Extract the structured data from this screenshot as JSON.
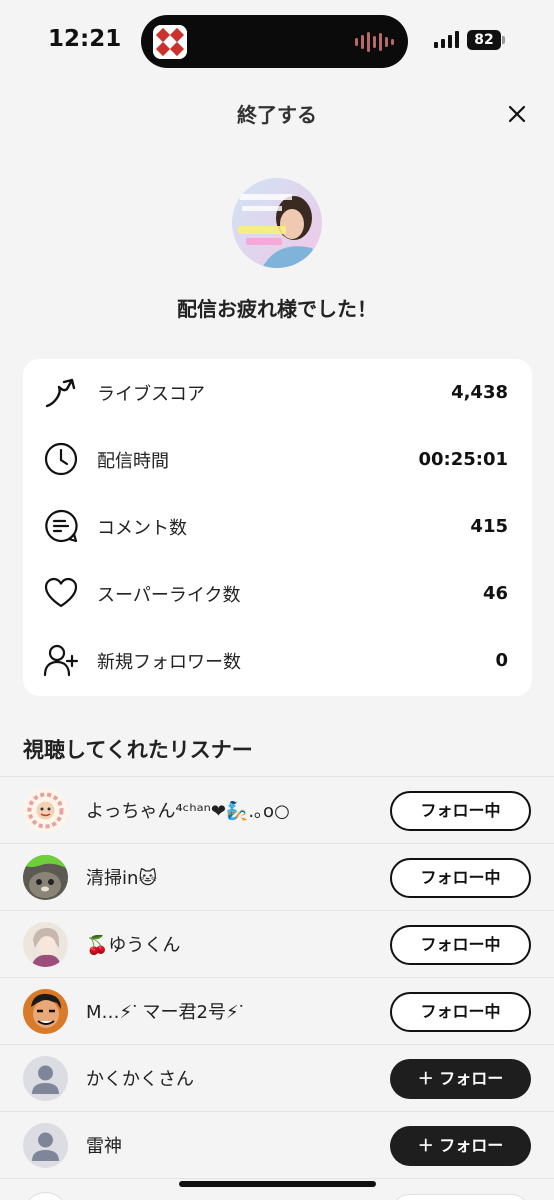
{
  "status_bar": {
    "time": "12:21",
    "battery": "82"
  },
  "header": {
    "title": "終了する"
  },
  "summary": {
    "message": "配信お疲れ様でした！"
  },
  "stats": [
    {
      "icon": "trend-up-arrow-icon",
      "label": "ライブスコア",
      "value": "4,438"
    },
    {
      "icon": "clock-icon",
      "label": "配信時間",
      "value": "00:25:01"
    },
    {
      "icon": "comment-icon",
      "label": "コメント数",
      "value": "415"
    },
    {
      "icon": "heart-icon",
      "label": "スーパーライク数",
      "value": "46"
    },
    {
      "icon": "add-user-icon",
      "label": "新規フォロワー数",
      "value": "0"
    }
  ],
  "listeners_section": {
    "title": "視聴してくれたリスナー"
  },
  "listeners": [
    {
      "name": "よっちゃん⁴ᶜʰᵃⁿ❤🧞.｡o○",
      "button": "フォロー中",
      "following": true
    },
    {
      "name": "清掃in🐱",
      "button": "フォロー中",
      "following": true
    },
    {
      "name": "🍒ゆうくん",
      "button": "フォロー中",
      "following": true
    },
    {
      "name": "M…⚡︎ᐝ マー君2号⚡︎ᐝ",
      "button": "フォロー中",
      "following": true
    },
    {
      "name": "かくかくさん",
      "button": "＋ フォロー",
      "following": false
    },
    {
      "name": "雷神",
      "button": "＋ フォロー",
      "following": false
    }
  ],
  "colors": {
    "background": "#f4f4f4",
    "card": "#ffffff",
    "follow_button": "#1e1e1e"
  }
}
